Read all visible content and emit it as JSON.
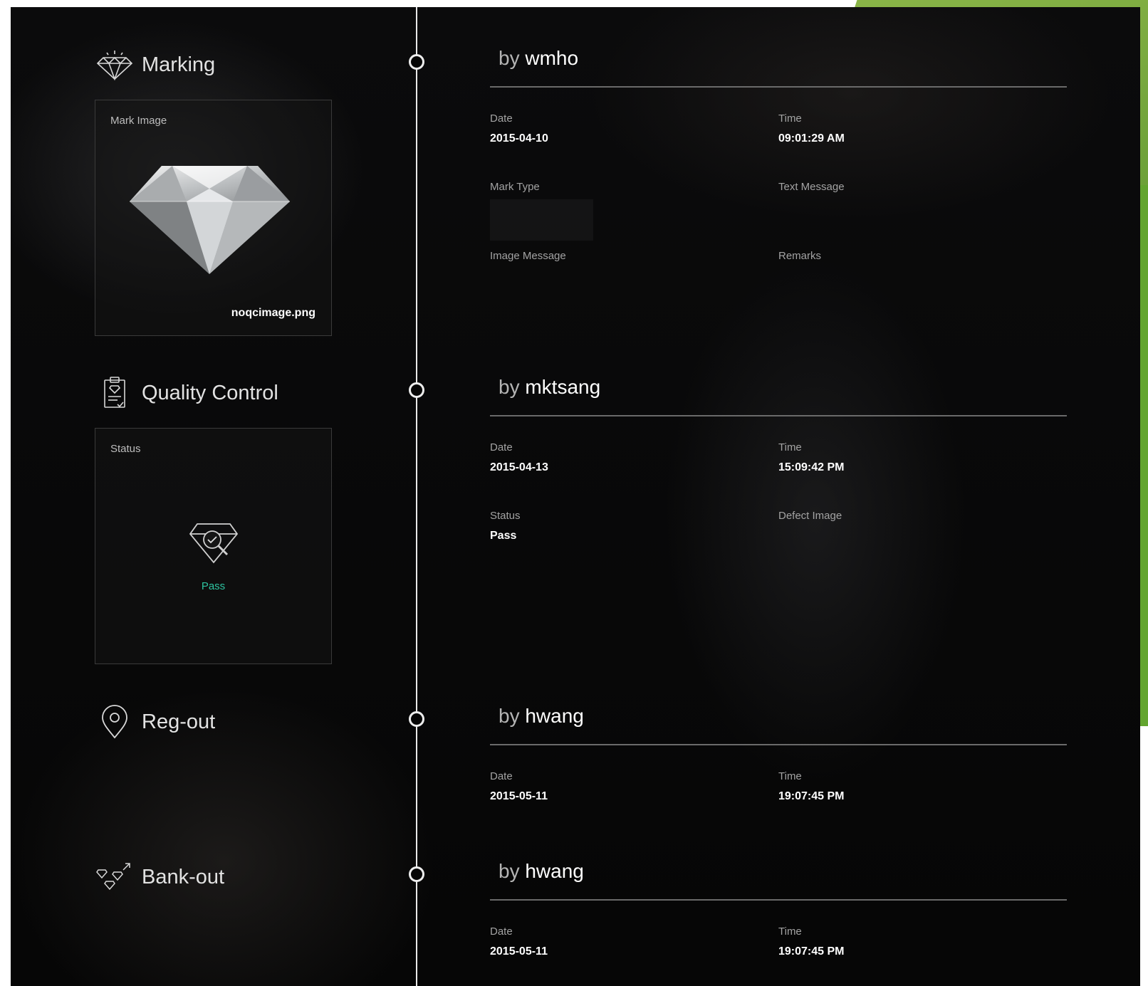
{
  "sections": [
    {
      "title": "Marking",
      "icon": "diamond-icon",
      "card": {
        "label": "Mark Image",
        "filename": "noqcimage.png"
      },
      "entry": {
        "by_prefix": "by",
        "user": "wmho",
        "fields": [
          {
            "label": "Date",
            "value": "2015-04-10"
          },
          {
            "label": "Time",
            "value": "09:01:29 AM"
          },
          {
            "label": "Mark Type",
            "value": ""
          },
          {
            "label": "Text Message",
            "value": ""
          },
          {
            "label": "Image Message",
            "value": ""
          },
          {
            "label": "Remarks",
            "value": ""
          }
        ]
      }
    },
    {
      "title": "Quality Control",
      "icon": "clipboard-check-icon",
      "card": {
        "label": "Status",
        "status": "Pass",
        "status_color": "#2ec4a0"
      },
      "entry": {
        "by_prefix": "by",
        "user": "mktsang",
        "fields": [
          {
            "label": "Date",
            "value": "2015-04-13"
          },
          {
            "label": "Time",
            "value": "15:09:42 PM"
          },
          {
            "label": "Status",
            "value": "Pass"
          },
          {
            "label": "Defect Image",
            "value": ""
          }
        ]
      }
    },
    {
      "title": "Reg-out",
      "icon": "location-pin-icon",
      "entry": {
        "by_prefix": "by",
        "user": "hwang",
        "fields": [
          {
            "label": "Date",
            "value": "2015-05-11"
          },
          {
            "label": "Time",
            "value": "19:07:45 PM"
          }
        ]
      }
    },
    {
      "title": "Bank-out",
      "icon": "diamonds-out-icon",
      "entry": {
        "by_prefix": "by",
        "user": "hwang",
        "fields": [
          {
            "label": "Date",
            "value": "2015-05-11"
          },
          {
            "label": "Time",
            "value": "19:07:45 PM"
          }
        ]
      }
    }
  ],
  "colors": {
    "background": "#060606",
    "accent_green": "#6fa23a",
    "pass": "#2ec4a0"
  }
}
